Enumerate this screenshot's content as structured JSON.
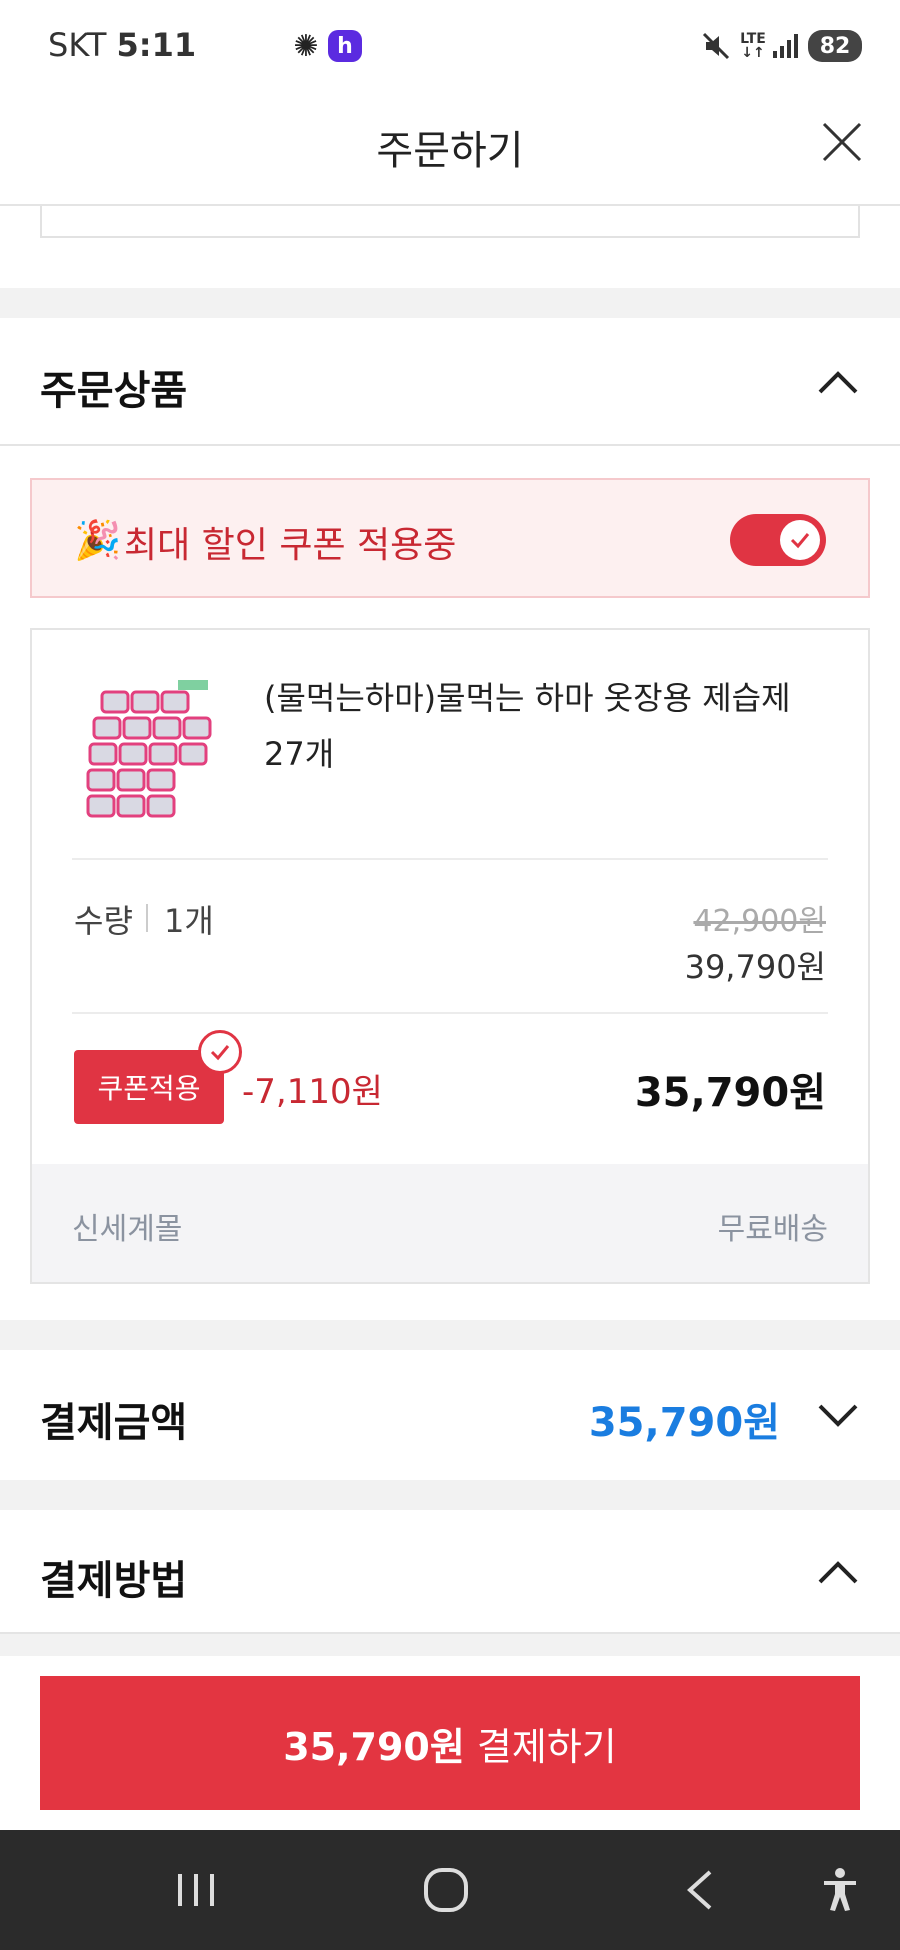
{
  "status_bar": {
    "carrier": "SKT",
    "time": "5:11",
    "network": "LTE",
    "battery": "82"
  },
  "header": {
    "title": "주문하기"
  },
  "order_items": {
    "title": "주문상품",
    "coupon_banner": {
      "text": "최대 할인 쿠폰 적용중",
      "toggle_on": true
    },
    "product": {
      "name": "(물먹는하마)물먹는 하마 옷장용 제습제 27개",
      "qty_label": "수량",
      "qty_value": "1개",
      "original_price": "42,900원",
      "sale_price": "39,790원",
      "coupon_button": "쿠폰적용",
      "discount": "-7,110원",
      "final_price": "35,790원",
      "seller": "신세계몰",
      "shipping": "무료배송"
    }
  },
  "payment_amount": {
    "title": "결제금액",
    "value": "35,790원"
  },
  "payment_method": {
    "title": "결제방법"
  },
  "pay_button": {
    "amount": "35,790원",
    "label": "결제하기"
  },
  "colors": {
    "accent_red": "#e33541",
    "amount_blue": "#1a7de0"
  }
}
